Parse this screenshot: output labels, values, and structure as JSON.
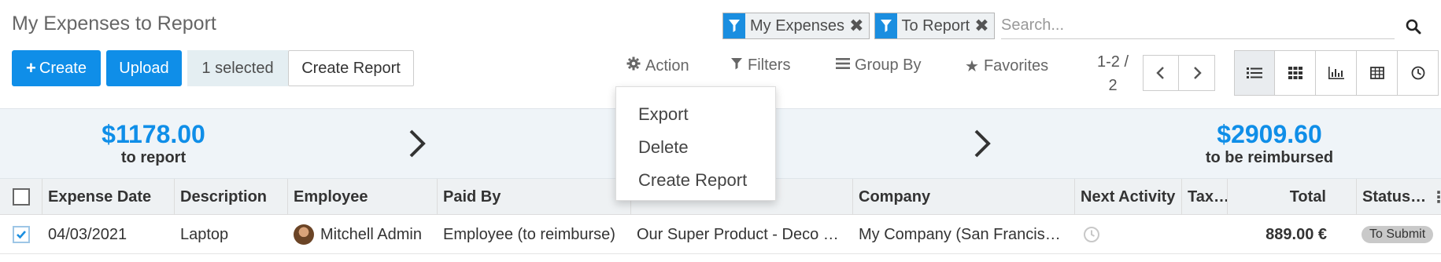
{
  "control_panel": {
    "title": "My Expenses to Report",
    "facets": [
      {
        "label": "My Expenses",
        "icon": "filter-icon"
      },
      {
        "label": "To Report",
        "icon": "filter-icon"
      }
    ],
    "search": {
      "placeholder": "Search..."
    },
    "buttons": {
      "create": "Create",
      "upload": "Upload",
      "selected": "1 selected",
      "create_report": "Create Report"
    },
    "menus": {
      "action": "Action",
      "filters": "Filters",
      "group_by": "Group By",
      "favorites": "Favorites"
    },
    "pager": {
      "range": "1-2 /",
      "total": "2"
    },
    "views": [
      "list",
      "kanban",
      "graph",
      "pivot",
      "activity"
    ],
    "accent_color": "#0f8ee8"
  },
  "action_dropdown": {
    "items": [
      "Export",
      "Delete",
      "Create Report"
    ]
  },
  "dashboard": {
    "to_report": {
      "amount": "$1178.00",
      "label": "to report"
    },
    "to_be_reimbursed": {
      "amount": "$2909.60",
      "label": "to be reimbursed"
    }
  },
  "table": {
    "columns": [
      "Expense Date",
      "Description",
      "Employee",
      "Paid By",
      "",
      "Company",
      "Next Activity",
      "Tax…",
      "Total",
      "Status…"
    ],
    "rows": [
      {
        "selected": true,
        "expense_date": "04/03/2021",
        "description": "Laptop",
        "employee": "Mitchell Admin",
        "paid_by": "Employee (to reimburse)",
        "product": "Our Super Product - Deco …",
        "company": "My Company (San Francis…",
        "next_activity": "",
        "tax": "",
        "total": "889.00 €",
        "status": "To Submit"
      }
    ]
  }
}
